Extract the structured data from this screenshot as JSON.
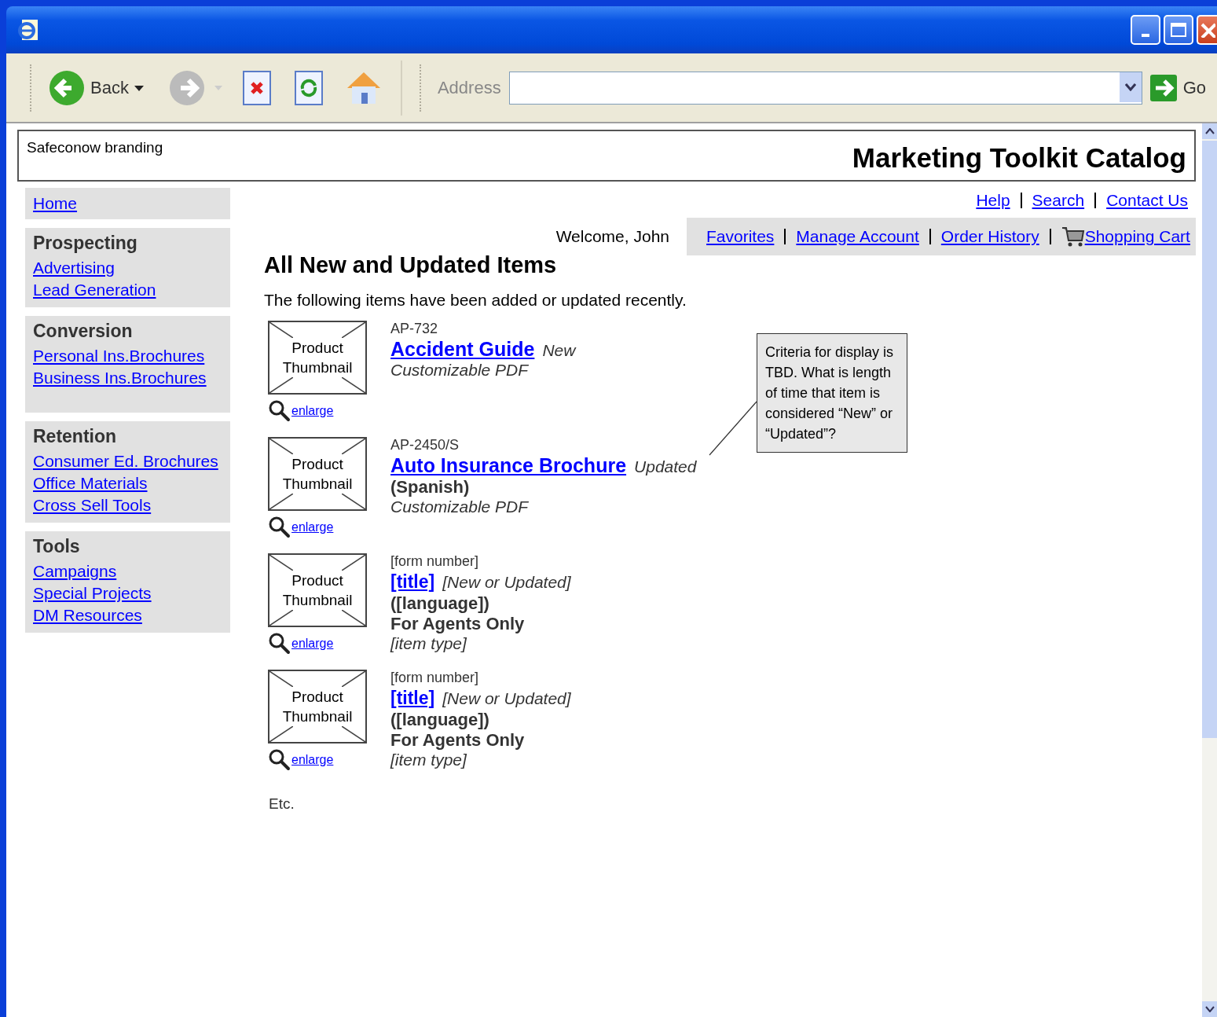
{
  "browser": {
    "back": "Back",
    "address_label": "Address",
    "go": "Go"
  },
  "header": {
    "branding": "Safeconow branding",
    "title": "Marketing Toolkit Catalog"
  },
  "utility_links": [
    "Help",
    "Search",
    "Contact Us"
  ],
  "welcome": "Welcome, John",
  "account_links": [
    {
      "label": "Favorites",
      "kind": "plain"
    },
    {
      "label": "Manage Account",
      "kind": "plain"
    },
    {
      "label": "Order History",
      "kind": "plain"
    },
    {
      "label": "Shopping Cart",
      "kind": "cart"
    }
  ],
  "sidebar": {
    "home": "Home",
    "sections": [
      {
        "title": "Prospecting",
        "links": [
          "Advertising",
          "Lead Generation"
        ]
      },
      {
        "title": "Conversion",
        "links": [
          "Personal Ins.Brochures",
          "Business Ins.Brochures"
        ]
      },
      {
        "title": "Retention",
        "links": [
          "Consumer Ed. Brochures",
          "Office Materials",
          "Cross Sell Tools"
        ]
      },
      {
        "title": "Tools",
        "links": [
          "Campaigns",
          "Special Projects",
          "DM Resources"
        ]
      }
    ]
  },
  "main": {
    "heading": "All New and Updated Items",
    "intro": "The following items have been added or updated recently.",
    "items": [
      {
        "thumbnail": "Product Thumbnail",
        "enlarge": "enlarge",
        "form_number": "AP-732",
        "title": "Accident Guide",
        "status": "New",
        "item_type": "Customizable PDF"
      },
      {
        "thumbnail": "Product Thumbnail",
        "enlarge": "enlarge",
        "form_number": "AP-2450/S",
        "title": "Auto Insurance Brochure ",
        "status": "Updated",
        "language": "(Spanish)",
        "item_type": "Customizable PDF"
      },
      {
        "thumbnail": "Product Thumbnail",
        "enlarge": "enlarge",
        "form_number": "[form number]",
        "title": "[title]",
        "status": "[New or Updated]",
        "language": "([language])",
        "audience": "For Agents Only",
        "item_type": "[item type]"
      },
      {
        "thumbnail": "Product Thumbnail",
        "enlarge": "enlarge",
        "form_number": "[form number]",
        "title": "[title]",
        "status": "[New or Updated]",
        "language": "([language])",
        "audience": "For Agents Only",
        "item_type": "[item type]"
      }
    ],
    "footer": "Etc."
  },
  "note": {
    "text": "Criteria for display is TBD. What is length of time that item is considered “New” or “Updated”?"
  }
}
